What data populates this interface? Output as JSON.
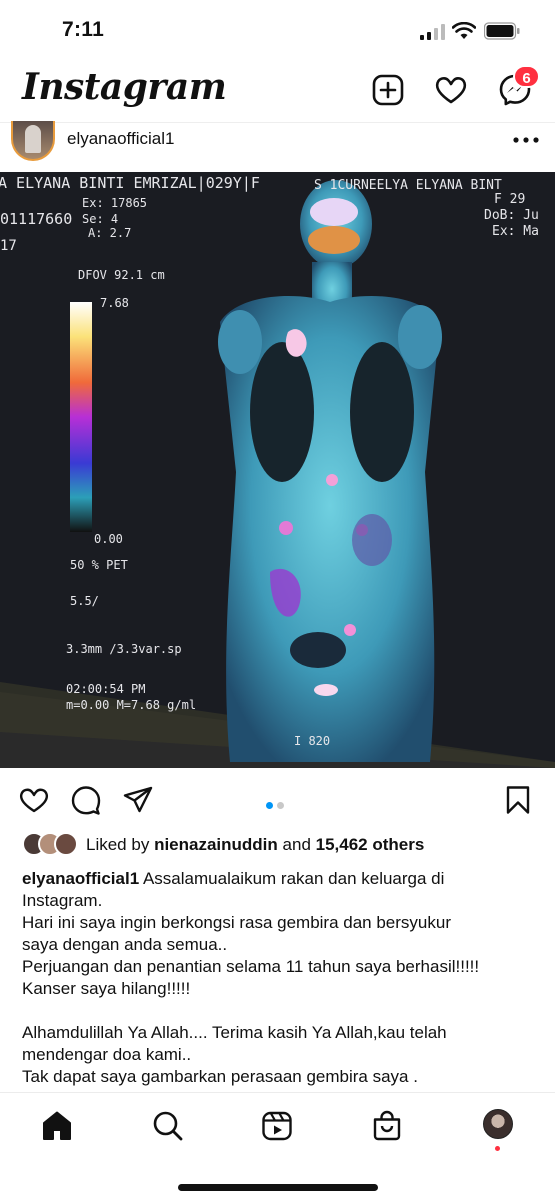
{
  "status_bar": {
    "time": "7:11"
  },
  "app": {
    "title": "Instagram",
    "notification_badge": "6",
    "icons": [
      "new-post-icon",
      "heart-icon",
      "messenger-icon"
    ]
  },
  "post": {
    "username": "elyanaofficial1",
    "scan_overlay": {
      "patient_left": "A ELYANA BINTI EMRIZAL|029Y|F",
      "patient_right": "S 1CURNEELYA ELYANA BINT",
      "ex_left": "Ex: 17865",
      "id": "01117660",
      "se": "Se: 4",
      "a": "A: 2.7",
      "year": "17",
      "f29": "F 29",
      "dob": "DoB: Ju",
      "ex_right": "Ex: Ma",
      "dfov": "DFOV 92.1 cm",
      "scale_max": "7.68",
      "scale_min": "0.00",
      "pet": "50 % PET",
      "level": "5.5/",
      "thickness": "3.3mm /3.3var.sp",
      "time": "02:00:54 PM",
      "range": "m=0.00 M=7.68 g/ml",
      "slice": "I 820"
    },
    "carousel": {
      "count": 2,
      "active": 0
    },
    "likes": {
      "prefix": "Liked by",
      "user": "nienazainuddin",
      "joiner": "and",
      "count": "15,462 others"
    },
    "caption": {
      "user": "elyanaofficial1",
      "lines": [
        "Assalamualaikum rakan dan keluarga di",
        "Instagram.",
        "Hari ini saya ingin berkongsi rasa gembira dan bersyukur",
        "saya dengan anda semua..",
        "Perjuangan dan penantian selama 11 tahun saya berhasil!!!!!",
        "Kanser saya hilang!!!!!",
        "",
        "Alhamdulillah Ya Allah.... Terima kasih Ya Allah,kau telah",
        "mendengar doa kami..",
        "Tak dapat saya gambarkan perasaan gembira saya ."
      ]
    }
  },
  "nav": {
    "items": [
      "home-icon",
      "search-icon",
      "reels-icon",
      "shop-icon",
      "profile-avatar"
    ]
  },
  "colors": {
    "accent": "#0095f6",
    "badge": "#ff3040"
  }
}
